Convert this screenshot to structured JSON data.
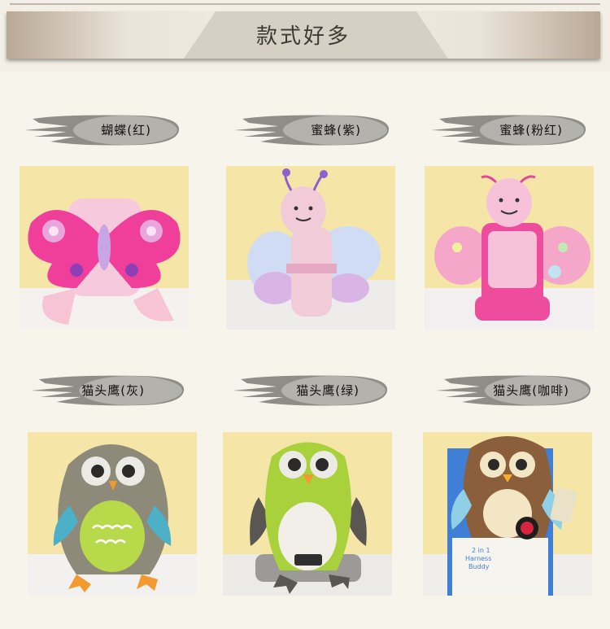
{
  "banner": {
    "title": "款式好多"
  },
  "products": [
    {
      "label": "蝴蝶(红)"
    },
    {
      "label": "蜜蜂(紫)"
    },
    {
      "label": "蜜蜂(粉红)"
    },
    {
      "label": "猫头鹰(灰)"
    },
    {
      "label": "猫头鹰(绿)"
    },
    {
      "label": "猫头鹰(咖啡)"
    }
  ],
  "box_text": {
    "line1": "2 in 1",
    "line2": "Harness",
    "line3": "Buddy"
  },
  "colors": {
    "background": "#f7f4ec",
    "photo_bg": "#f6e7b0",
    "label_gray": "#8f8d88"
  }
}
